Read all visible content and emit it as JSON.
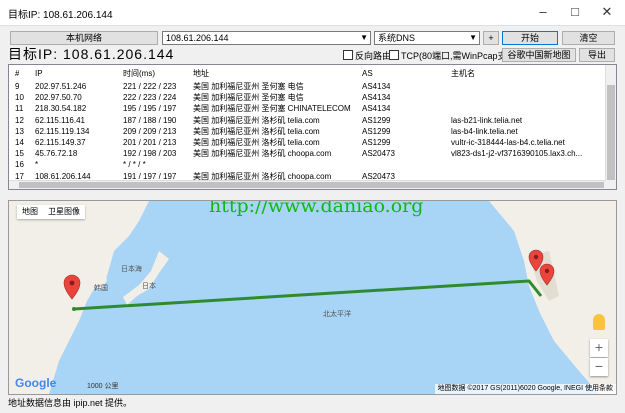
{
  "window": {
    "title": "目标IP: 108.61.206.144",
    "min_icon": "minimize-icon",
    "max_icon": "maximize-icon",
    "close_icon": "close-icon"
  },
  "toolbar": {
    "local_network_label": "本机网络",
    "target_value": "108.61.206.144",
    "dns_value": "系统DNS",
    "add_label": "+",
    "start_label": "开始",
    "clear_label": "清空",
    "google_map_label": "谷歌中国新地图",
    "export_label": "导出",
    "reverse_route_label": "反向路由",
    "tcp_label": "TCP(80端口,需WinPcap支持)",
    "big_target": "目标IP:  108.61.206.144"
  },
  "table": {
    "columns": [
      "#",
      "IP",
      "时间(ms)",
      "地址",
      "AS",
      "主机名"
    ],
    "rows": [
      [
        "9",
        "202.97.51.246",
        "221 / 222 / 223",
        "美国 加利福尼亚州 圣何塞 电信",
        "AS4134",
        ""
      ],
      [
        "10",
        "202.97.50.70",
        "222 / 223 / 224",
        "美国 加利福尼亚州 圣何塞 电信",
        "AS4134",
        ""
      ],
      [
        "11",
        "218.30.54.182",
        "195 / 195 / 197",
        "美国 加利福尼亚州 圣何塞 CHINATELECOM",
        "AS4134",
        ""
      ],
      [
        "12",
        "62.115.116.41",
        "187 / 188 / 190",
        "美国 加利福尼亚州 洛杉矶 telia.com",
        "AS1299",
        "las-b21-link.telia.net"
      ],
      [
        "13",
        "62.115.119.134",
        "209 / 209 / 213",
        "美国 加利福尼亚州 洛杉矶 telia.com",
        "AS1299",
        "las-b4-link.telia.net"
      ],
      [
        "14",
        "62.115.149.37",
        "201 / 201 / 213",
        "美国 加利福尼亚州 洛杉矶 telia.com",
        "AS1299",
        "vultr-ic-318444-las-b4.c.telia.net"
      ],
      [
        "15",
        "45.76.72.18",
        "192 / 198 / 203",
        "美国 加利福尼亚州 洛杉矶 choopa.com",
        "AS20473",
        "vl823-ds1-j2-vf3716390105.lax3.ch..."
      ],
      [
        "16",
        "*",
        "* / * / *",
        "",
        "",
        ""
      ],
      [
        "17",
        "108.61.206.144",
        "191 / 197 / 197",
        "美国 加利福尼亚州 洛杉矶 choopa.com",
        "AS20473",
        ""
      ]
    ]
  },
  "map": {
    "tab_map": "地图",
    "tab_satellite": "卫星图像",
    "watermark": "http://www.daniao.org",
    "labels": {
      "korea": "韩国",
      "japan": "日本",
      "sea_of_japan": "日本海",
      "pacific": "北太平洋"
    },
    "zoom_in": "+",
    "zoom_out": "−",
    "google": "Google",
    "scale": "1000 公里",
    "attribution": "地图数据 ©2017 GS(2011)6020 Google, INEGI   使用条款",
    "route_color": "#2e8b2e",
    "marker_color": "#e8453c"
  },
  "status": {
    "text": "地址数据信息由 ipip.net 提供。"
  }
}
